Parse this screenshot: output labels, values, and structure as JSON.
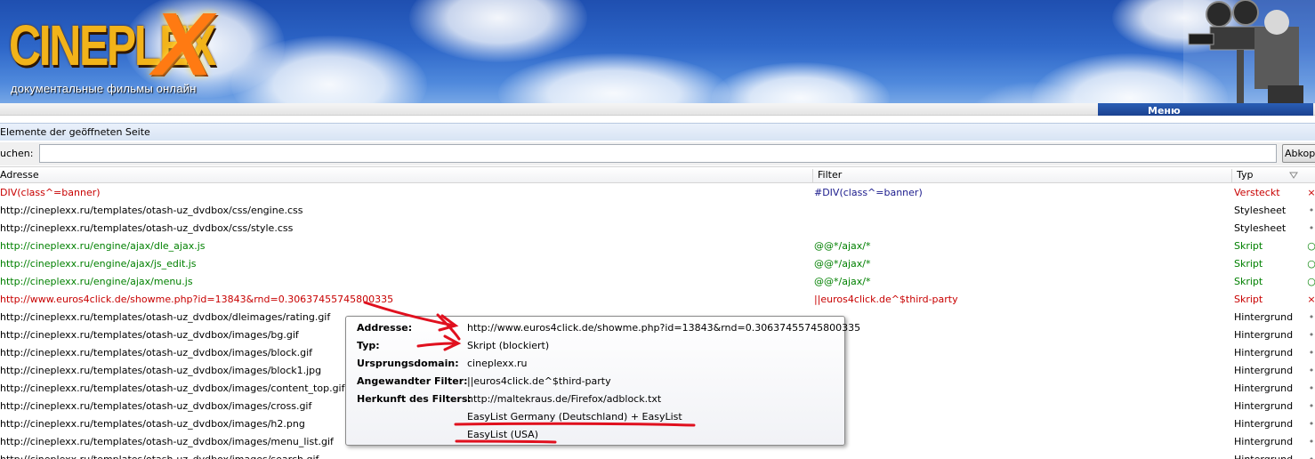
{
  "banner": {
    "logo_text": "CINEPLEX",
    "logo_x": "X",
    "logo_subtitle": "документальные фильмы онлайн",
    "menu_label": "Меню"
  },
  "window": {
    "title": "Elemente der geöffneten Seite"
  },
  "search": {
    "label": "uchen:",
    "value": "",
    "button_label": "Abkop"
  },
  "columns": {
    "address": "Adresse",
    "filter": "Filter",
    "type": "Typ"
  },
  "rows": [
    {
      "address": "DIV(class^=banner)",
      "filter": "#DIV(class^=banner)",
      "type": "Versteckt",
      "status": "hidden",
      "icon": "×"
    },
    {
      "address": "http://cineplexx.ru/templates/otash-uz_dvdbox/css/engine.css",
      "filter": "",
      "type": "Stylesheet",
      "status": "normal",
      "icon": "•"
    },
    {
      "address": "http://cineplexx.ru/templates/otash-uz_dvdbox/css/style.css",
      "filter": "",
      "type": "Stylesheet",
      "status": "normal",
      "icon": "•"
    },
    {
      "address": "http://cineplexx.ru/engine/ajax/dle_ajax.js",
      "filter": "@@*/ajax/*",
      "type": "Skript",
      "status": "whitelist",
      "icon": "○"
    },
    {
      "address": "http://cineplexx.ru/engine/ajax/js_edit.js",
      "filter": "@@*/ajax/*",
      "type": "Skript",
      "status": "whitelist",
      "icon": "○"
    },
    {
      "address": "http://cineplexx.ru/engine/ajax/menu.js",
      "filter": "@@*/ajax/*",
      "type": "Skript",
      "status": "whitelist",
      "icon": "○"
    },
    {
      "address": "http://www.euros4click.de/showme.php?id=13843&rnd=0.30637455745800335",
      "filter": "||euros4click.de^$third-party",
      "type": "Skript",
      "status": "blocked",
      "icon": "×"
    },
    {
      "address": "http://cineplexx.ru/templates/otash-uz_dvdbox/dleimages/rating.gif",
      "filter": "",
      "type": "Hintergrund",
      "status": "normal",
      "icon": "•"
    },
    {
      "address": "http://cineplexx.ru/templates/otash-uz_dvdbox/images/bg.gif",
      "filter": "",
      "type": "Hintergrund",
      "status": "normal",
      "icon": "•"
    },
    {
      "address": "http://cineplexx.ru/templates/otash-uz_dvdbox/images/block.gif",
      "filter": "",
      "type": "Hintergrund",
      "status": "normal",
      "icon": "•"
    },
    {
      "address": "http://cineplexx.ru/templates/otash-uz_dvdbox/images/block1.jpg",
      "filter": "",
      "type": "Hintergrund",
      "status": "normal",
      "icon": "•"
    },
    {
      "address": "http://cineplexx.ru/templates/otash-uz_dvdbox/images/content_top.gif",
      "filter": "",
      "type": "Hintergrund",
      "status": "normal",
      "icon": "•"
    },
    {
      "address": "http://cineplexx.ru/templates/otash-uz_dvdbox/images/cross.gif",
      "filter": "",
      "type": "Hintergrund",
      "status": "normal",
      "icon": "•"
    },
    {
      "address": "http://cineplexx.ru/templates/otash-uz_dvdbox/images/h2.png",
      "filter": "",
      "type": "Hintergrund",
      "status": "normal",
      "icon": "•"
    },
    {
      "address": "http://cineplexx.ru/templates/otash-uz_dvdbox/images/menu_list.gif",
      "filter": "",
      "type": "Hintergrund",
      "status": "normal",
      "icon": "•"
    },
    {
      "address": "http://cineplexx.ru/templates/otash-uz_dvdbox/images/search.gif",
      "filter": "",
      "type": "Hintergrund",
      "status": "normal",
      "icon": "•"
    }
  ],
  "tooltip": {
    "address_label": "Addresse:",
    "address_value": "http://www.euros4click.de/showme.php?id=13843&rnd=0.30637455745800335",
    "type_label": "Typ:",
    "type_value": "Skript (blockiert)",
    "origin_label": "Ursprungsdomain:",
    "origin_value": "cineplexx.ru",
    "filter_label": "Angewandter Filter:",
    "filter_value": "||euros4click.de^$third-party",
    "source_label": "Herkunft des Filters:",
    "source_value": "http://maltekraus.de/Firefox/adblock.txt",
    "source_value_2": "EasyList Germany (Deutschland) + EasyList",
    "source_value_3": "EasyList (USA)"
  },
  "colors": {
    "blocked": "#c80000",
    "whitelist": "#008000",
    "annotation": "#e0101e"
  }
}
